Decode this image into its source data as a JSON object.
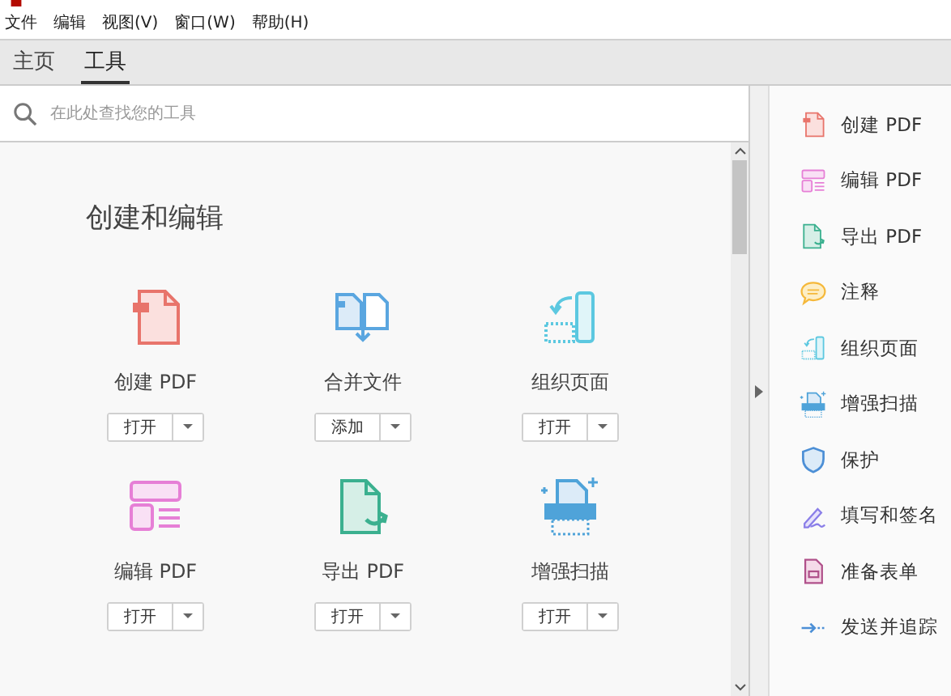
{
  "menu": [
    "文件",
    "编辑",
    "视图(V)",
    "窗口(W)",
    "帮助(H)"
  ],
  "tabs": [
    {
      "label": "主页",
      "selected": false
    },
    {
      "label": "工具",
      "selected": true
    }
  ],
  "search": {
    "placeholder": "在此处查找您的工具"
  },
  "section": {
    "title": "创建和编辑",
    "tools": [
      {
        "name": "创建 PDF",
        "button": "打开"
      },
      {
        "name": "合并文件",
        "button": "添加"
      },
      {
        "name": "组织页面",
        "button": "打开"
      },
      {
        "name": "编辑 PDF",
        "button": "打开"
      },
      {
        "name": "导出 PDF",
        "button": "打开"
      },
      {
        "name": "增强扫描",
        "button": "打开"
      }
    ]
  },
  "sidebar": {
    "items": [
      "创建 PDF",
      "编辑 PDF",
      "导出 PDF",
      "注释",
      "组织页面",
      "增强扫描",
      "保护",
      "填写和签名",
      "准备表单",
      "发送并追踪"
    ]
  }
}
